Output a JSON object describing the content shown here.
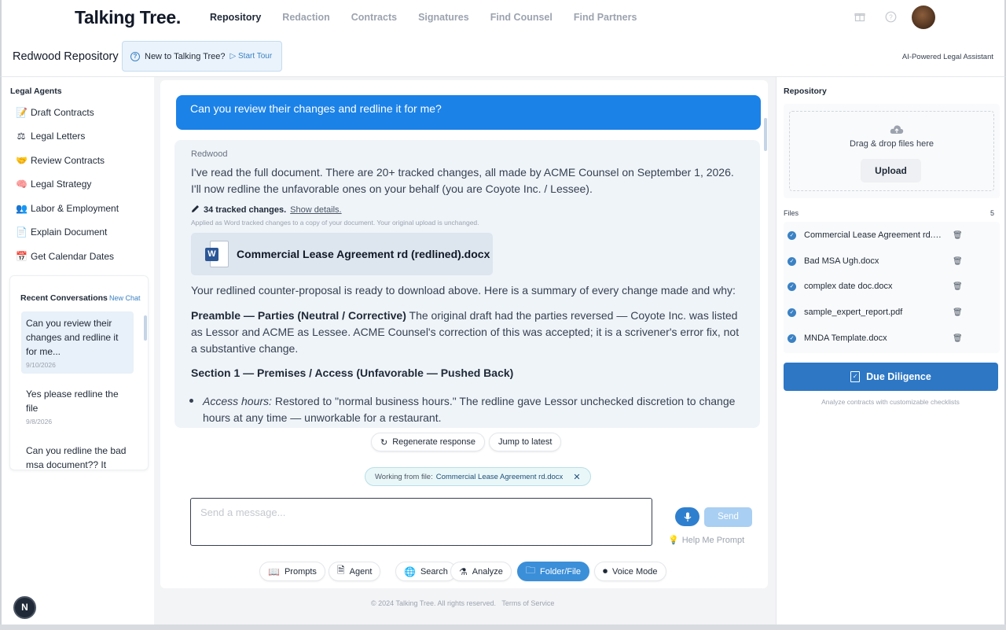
{
  "app": {
    "logo": "Talking Tree."
  },
  "nav": {
    "items": [
      "Repository",
      "Redaction",
      "Contracts",
      "Signatures",
      "Find Counsel",
      "Find Partners"
    ],
    "active": "Repository"
  },
  "header": {
    "repo_name": "Redwood Repository",
    "tour_text": "New to Talking Tree?",
    "start_tour": "Start Tour",
    "ai_assistant": "AI-Powered Legal Assistant"
  },
  "left": {
    "agents_title": "Legal Agents",
    "agents": [
      {
        "label": "Draft Contracts",
        "icon": "memo-icon"
      },
      {
        "label": "Legal Letters",
        "icon": "scales-icon"
      },
      {
        "label": "Review Contracts",
        "icon": "handshake-icon"
      },
      {
        "label": "Legal Strategy",
        "icon": "brain-icon"
      },
      {
        "label": "Labor & Employment",
        "icon": "people-icon"
      },
      {
        "label": "Explain Document",
        "icon": "page-icon"
      },
      {
        "label": "Get Calendar Dates",
        "icon": "calendar-icon"
      }
    ],
    "recent_title": "Recent Conversations",
    "new_chat": "New Chat",
    "conversations": [
      {
        "title": "Can you review their changes and redline it for me...",
        "date": "9/10/2026"
      },
      {
        "title": "Yes please redline the file",
        "date": "9/8/2026"
      },
      {
        "title": "Can you redline the bad msa document?? It",
        "date": ""
      }
    ]
  },
  "chat": {
    "user_message": "Can you review their changes and redline it for me?",
    "assistant_name": "Redwood",
    "para1": "I've read the full document. There are 20+ tracked changes, all made by ACME Counsel on September 1, 2026. I'll now redline the unfavorable ones on your behalf (you are Coyote Inc. / Lessee).",
    "tracked_count": "34 tracked changes.",
    "show_details": "Show details.",
    "applied_note": "Applied as Word tracked changes to a copy of your document. Your original upload is unchanged.",
    "file_name": "Commercial Lease Agreement rd (redlined).docx",
    "para2": "Your redlined counter-proposal is ready to download above. Here is a summary of every change made and why:",
    "preamble_title": "Preamble — Parties (Neutral / Corrective)",
    "preamble_text": " The original draft had the parties reversed — Coyote Inc. was listed as Lessor and ACME as Lessee. ACME Counsel's correction of this was accepted; it is a scrivener's error fix, not a substantive change.",
    "section1_title": "Section 1 — Premises / Access (Unfavorable — Pushed Back)",
    "bullet_label": "Access hours:",
    "bullet_text": " Restored to \"normal business hours.\" The redline gave Lessor unchecked discretion to change hours at any time — unworkable for a restaurant."
  },
  "actions": {
    "regenerate": "Regenerate response",
    "jump": "Jump to latest"
  },
  "working": {
    "prefix": "Working from file:",
    "file": "Commercial Lease Agreement rd.docx"
  },
  "composer": {
    "placeholder": "Send a message...",
    "send": "Send",
    "help": "Help Me Prompt"
  },
  "tools": [
    "Prompts",
    "Agent",
    "Search",
    "Analyze",
    "Folder/File",
    "Voice Mode"
  ],
  "footer": {
    "copyright": "© 2024 Talking Tree. All rights reserved.",
    "terms": "Terms of Service"
  },
  "right": {
    "title": "Repository",
    "drop_text": "Drag & drop files here",
    "upload": "Upload",
    "files_label": "Files",
    "files_count": "5",
    "files": [
      "Commercial Lease Agreement rd.docx",
      "Bad MSA Ugh.docx",
      "complex date doc.docx",
      "sample_expert_report.pdf",
      "MNDA Template.docx"
    ],
    "due_diligence": "Due Diligence",
    "due_caption": "Analyze contracts with customizable checklists"
  },
  "badge": "N",
  "colors": {
    "accent": "#1b82e8",
    "primary_button": "#2d77c5",
    "active_tool": "#3b8fd9"
  }
}
